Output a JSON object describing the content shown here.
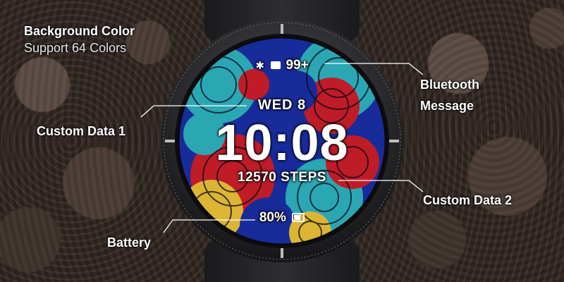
{
  "labels": {
    "background_color_title": "Background Color",
    "background_color_sub": "Support 64 Colors",
    "custom_data_1": "Custom Data 1",
    "bluetooth": "Bluetooth",
    "message": "Message",
    "custom_data_2": "Custom Data 2",
    "battery": "Battery"
  },
  "watch": {
    "date": "WED 8",
    "time": "10:08",
    "steps": "12570 STEPS",
    "battery_level": "80%",
    "notification_count": "99+"
  },
  "colors": {
    "label_text": "#ffffff",
    "connector_line": "#ffffff",
    "bezel": "#2b2b2e",
    "face_red": "#d11f2b",
    "face_blue": "#1b2fa8",
    "face_teal": "#2fb6c4",
    "face_yellow": "#f0c53a"
  },
  "icons": {
    "bluetooth": "bluetooth-icon",
    "message": "message-icon",
    "battery": "battery-icon"
  }
}
